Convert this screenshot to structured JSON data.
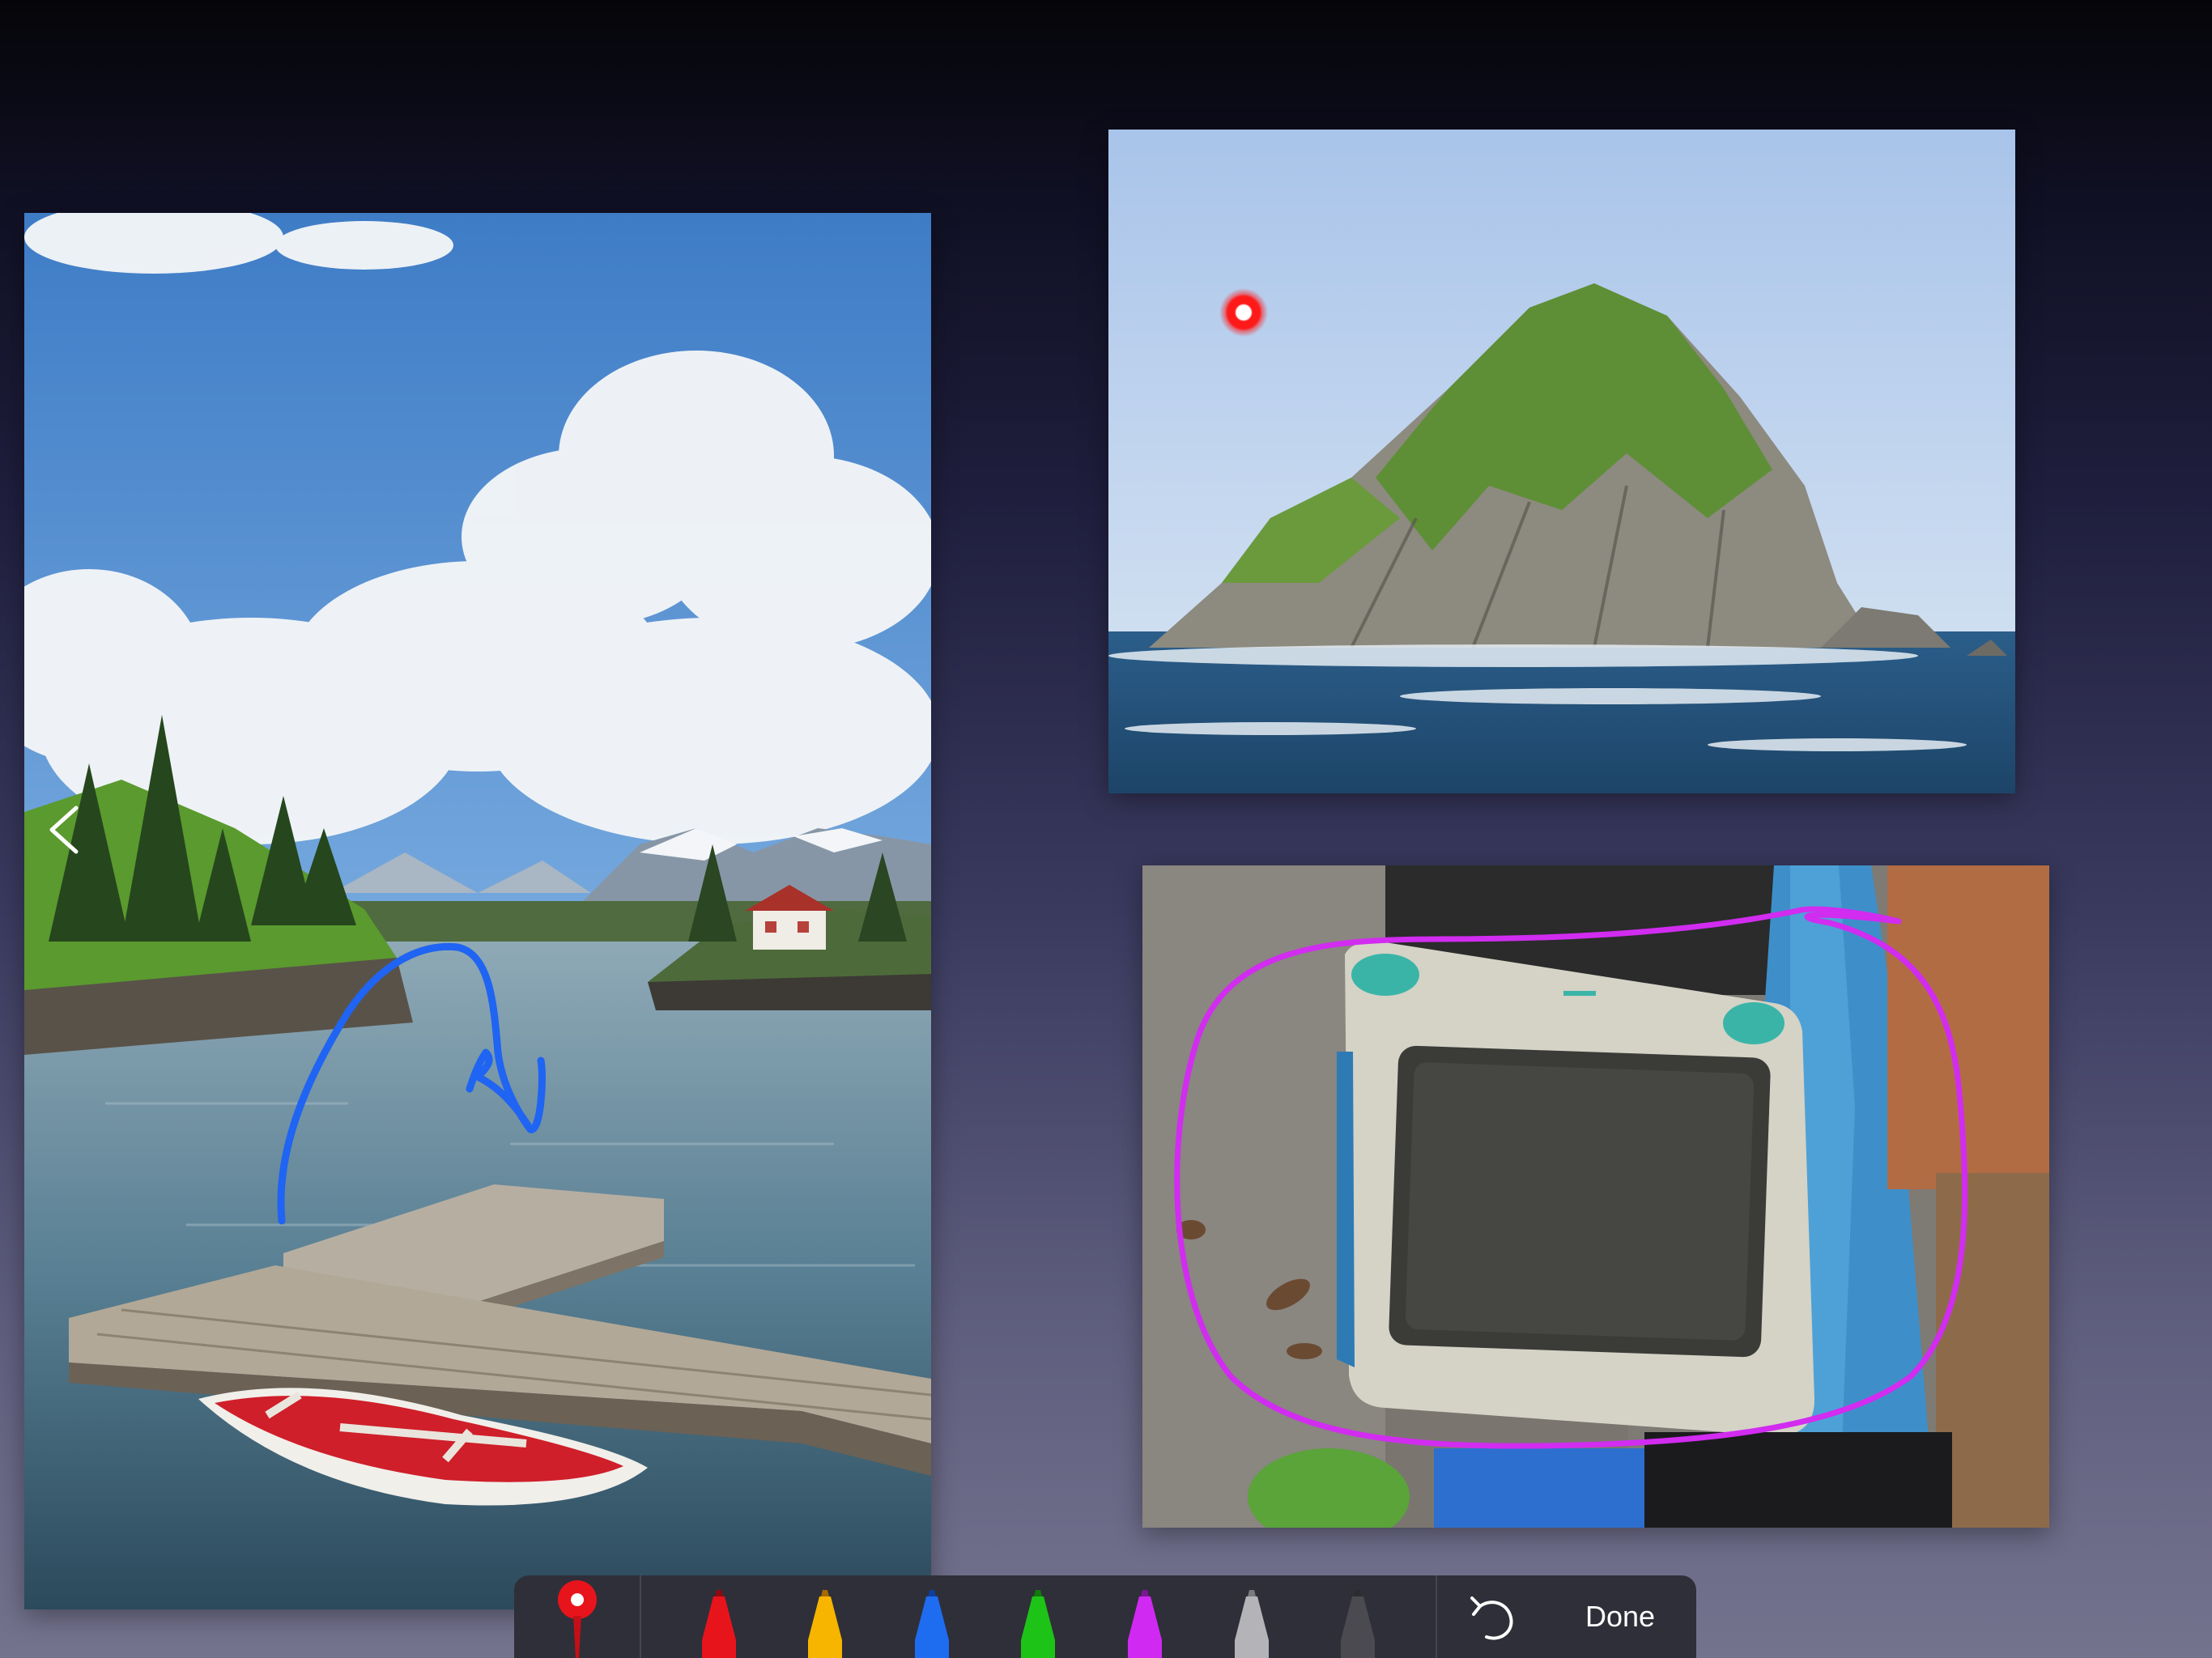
{
  "toolbar": {
    "done_label": "Done",
    "undo_icon": "undo-arrow-icon",
    "tools": [
      {
        "name": "laser-pointer",
        "color": "#e8141b"
      },
      {
        "name": "red-marker",
        "color": "#e8141b"
      },
      {
        "name": "yellow-marker",
        "color": "#f7b500"
      },
      {
        "name": "blue-marker",
        "color": "#1e6cf0"
      },
      {
        "name": "green-marker",
        "color": "#1ec318"
      },
      {
        "name": "purple-marker",
        "color": "#d02af2"
      },
      {
        "name": "light-gray-marker",
        "color": "#b4b4b8"
      },
      {
        "name": "dark-gray-marker",
        "color": "#4a4a50"
      }
    ]
  },
  "annotations": {
    "harbor_stroke_color": "#1f64f2",
    "imac_stroke_color": "#d12cf0",
    "laser_color": "#ff1a1a"
  },
  "navigation": {
    "back_icon": "chevron-left-icon"
  }
}
